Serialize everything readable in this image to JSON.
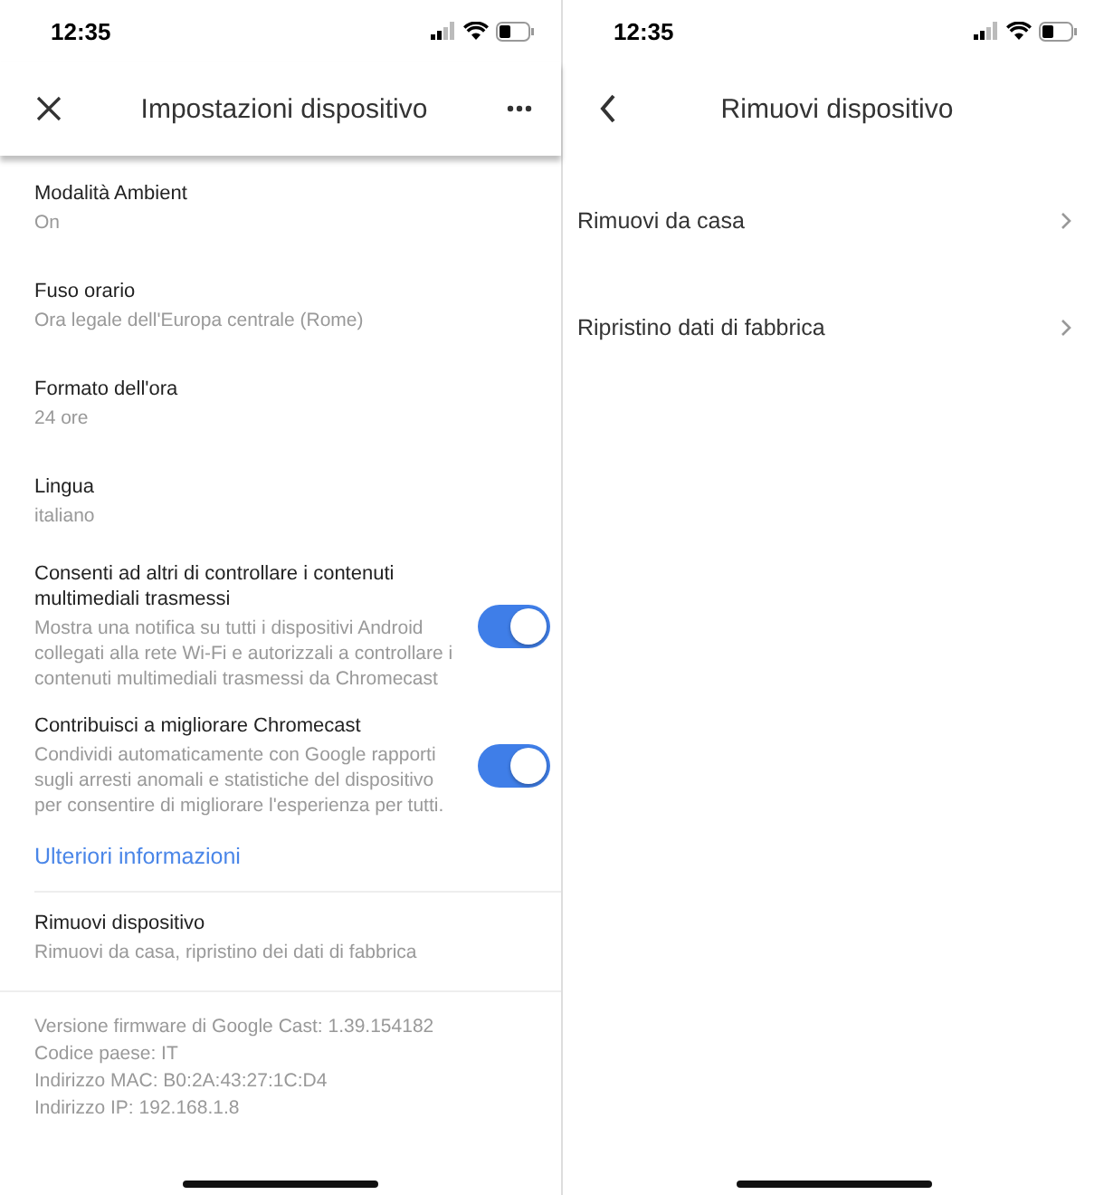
{
  "left_screen": {
    "status_bar": {
      "time": "12:35"
    },
    "header": {
      "title": "Impostazioni dispositivo"
    },
    "settings": [
      {
        "kind": "info",
        "title": "Modalità Ambient",
        "subtitle": "On"
      },
      {
        "kind": "info",
        "title": "Fuso orario",
        "subtitle": "Ora legale dell'Europa centrale (Rome)"
      },
      {
        "kind": "info",
        "title": "Formato dell'ora",
        "subtitle": "24 ore"
      },
      {
        "kind": "info",
        "title": "Lingua",
        "subtitle": "italiano"
      },
      {
        "kind": "toggle",
        "title": "Consenti ad altri di controllare i contenuti multimediali trasmessi",
        "subtitle": "Mostra una notifica su tutti i dispositivi Android collegati alla rete Wi-Fi e autorizzali a controllare i contenuti multimediali trasmessi da Chromecast",
        "on": true
      },
      {
        "kind": "toggle",
        "title": "Contribuisci a migliorare Chromecast",
        "subtitle": "Condividi automaticamente con Google rapporti sugli arresti anomali e statistiche del dispositivo per consentire di migliorare l'esperienza per tutti.",
        "on": true
      },
      {
        "kind": "link",
        "title": "Ulteriori informazioni"
      },
      {
        "kind": "info",
        "title": "Rimuovi dispositivo",
        "subtitle": "Rimuovi da casa, ripristino dei dati di fabbrica"
      }
    ],
    "device_info": [
      "Versione firmware di Google Cast: 1.39.154182",
      "Codice paese: IT",
      "Indirizzo MAC: B0:2A:43:27:1C:D4",
      "Indirizzo IP: 192.168.1.8"
    ]
  },
  "right_screen": {
    "status_bar": {
      "time": "12:35"
    },
    "header": {
      "title": "Rimuovi dispositivo"
    },
    "items": [
      "Rimuovi da casa",
      "Ripristino dati di fabbrica"
    ]
  }
}
